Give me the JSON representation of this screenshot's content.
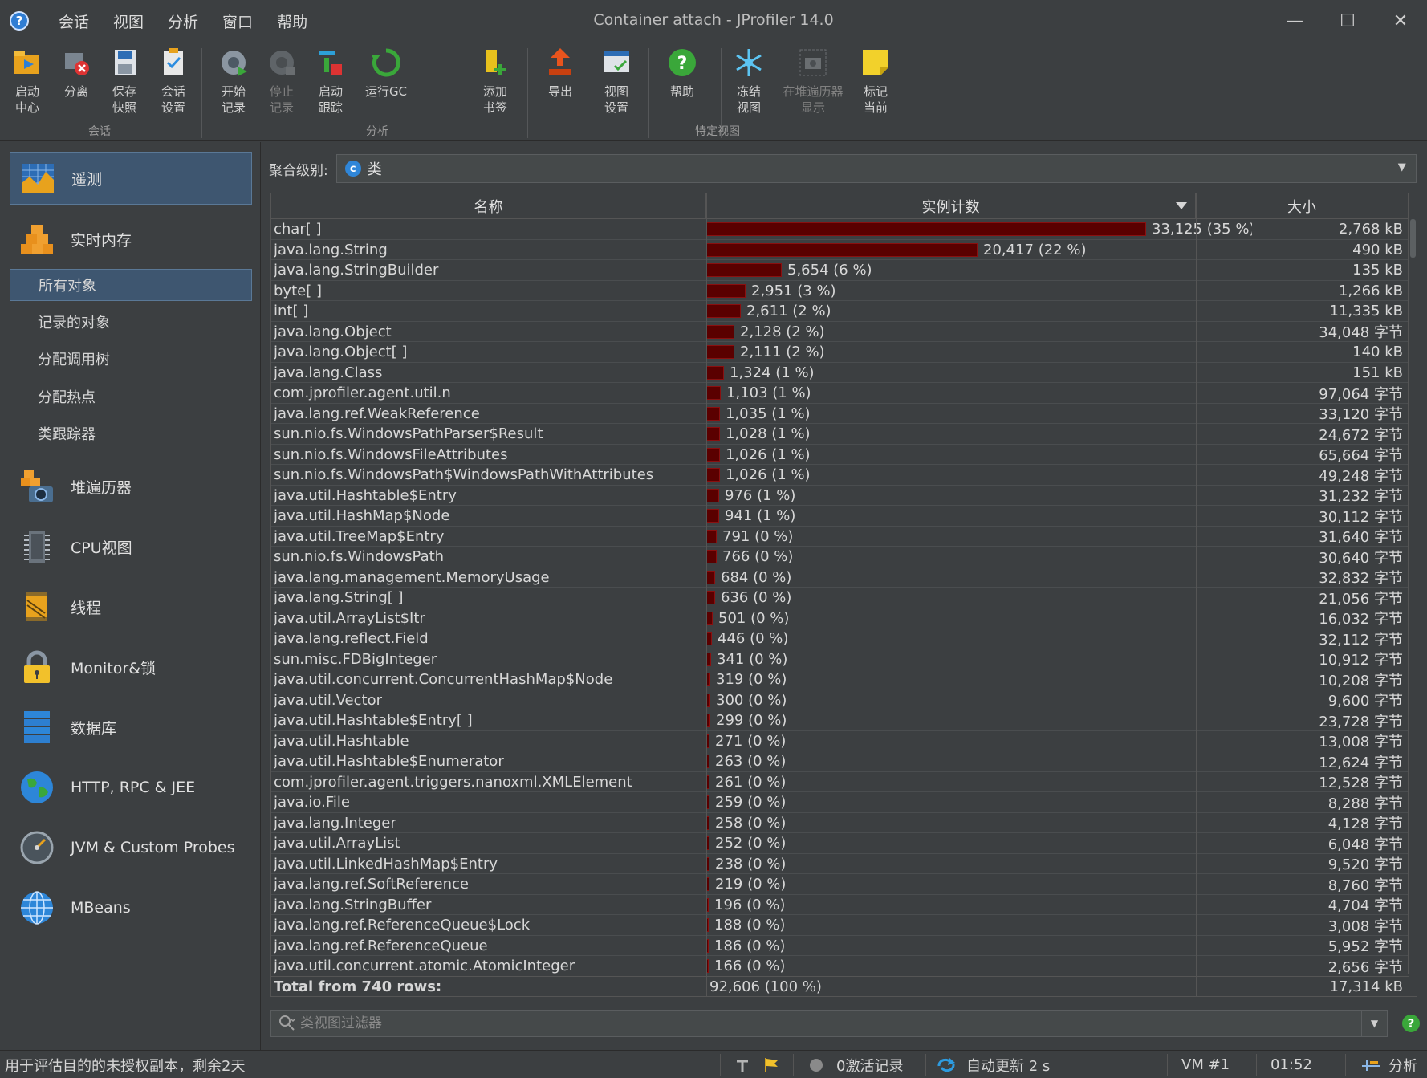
{
  "app": {
    "title": "Container attach - JProfiler 14.0",
    "menu": [
      "会话",
      "视图",
      "分析",
      "窗口",
      "帮助"
    ],
    "window_controls": {
      "minimize": "—",
      "maximize": "☐",
      "close": "✕"
    }
  },
  "toolbar": {
    "buttons": [
      {
        "label": "启动\n中心",
        "icon": "start-center-icon",
        "enabled": true
      },
      {
        "label": "分离",
        "icon": "detach-icon",
        "enabled": true
      },
      {
        "label": "保存\n快照",
        "icon": "save-snapshot-icon",
        "enabled": true
      },
      {
        "label": "会话\n设置",
        "icon": "session-settings-icon",
        "enabled": true
      },
      {
        "label": "开始\n记录",
        "icon": "start-recording-icon",
        "enabled": true
      },
      {
        "label": "停止\n记录",
        "icon": "stop-recording-icon",
        "enabled": false
      },
      {
        "label": "启动\n跟踪",
        "icon": "start-tracking-icon",
        "enabled": true
      },
      {
        "label": "运行GC",
        "icon": "run-gc-icon",
        "enabled": true
      },
      {
        "label": "添加\n书签",
        "icon": "add-bookmark-icon",
        "enabled": true
      },
      {
        "label": "导出",
        "icon": "export-icon",
        "enabled": true
      },
      {
        "label": "视图\n设置",
        "icon": "view-settings-icon",
        "enabled": true
      },
      {
        "label": "帮助",
        "icon": "help-icon",
        "enabled": true
      },
      {
        "label": "冻结\n视图",
        "icon": "freeze-view-icon",
        "enabled": true
      },
      {
        "label": "在堆遍历器\n显示",
        "icon": "show-in-heap-walker-icon",
        "enabled": false
      },
      {
        "label": "标记\n当前",
        "icon": "mark-current-icon",
        "enabled": true
      }
    ],
    "groups": [
      "会话",
      "分析",
      "特定视图"
    ]
  },
  "sidebar": {
    "sections": [
      {
        "label": "遥测",
        "icon": "telemetry-icon",
        "selected": true
      },
      {
        "label": "实时内存",
        "icon": "live-memory-icon",
        "selected": false
      },
      {
        "label": "堆遍历器",
        "icon": "heap-walker-icon",
        "selected": false
      },
      {
        "label": "CPU视图",
        "icon": "cpu-views-icon",
        "selected": false
      },
      {
        "label": "线程",
        "icon": "threads-icon",
        "selected": false
      },
      {
        "label": "Monitor&锁",
        "icon": "monitors-locks-icon",
        "selected": false
      },
      {
        "label": "数据库",
        "icon": "databases-icon",
        "selected": false
      },
      {
        "label": "HTTP, RPC & JEE",
        "icon": "http-rpc-jee-icon",
        "selected": false
      },
      {
        "label": "JVM & Custom Probes",
        "icon": "jvm-probes-icon",
        "selected": false
      },
      {
        "label": "MBeans",
        "icon": "mbeans-icon",
        "selected": false
      }
    ],
    "live_memory_items": [
      {
        "label": "所有对象",
        "selected": true
      },
      {
        "label": "记录的对象",
        "selected": false
      },
      {
        "label": "分配调用树",
        "selected": false
      },
      {
        "label": "分配热点",
        "selected": false
      },
      {
        "label": "类跟踪器",
        "selected": false
      }
    ]
  },
  "aggregation": {
    "label": "聚合级别:",
    "value": "类",
    "icon": "class-icon",
    "icon_letter": "c"
  },
  "table": {
    "columns": [
      "名称",
      "实例计数",
      "大小"
    ],
    "max_count": 33125,
    "rows": [
      {
        "name": "char[ ]",
        "count": 33125,
        "count_text": "33,125 (35 %)",
        "size": "2,768 kB"
      },
      {
        "name": "java.lang.String",
        "count": 20417,
        "count_text": "20,417 (22 %)",
        "size": "490 kB"
      },
      {
        "name": "java.lang.StringBuilder",
        "count": 5654,
        "count_text": "5,654 (6 %)",
        "size": "135 kB"
      },
      {
        "name": "byte[ ]",
        "count": 2951,
        "count_text": "2,951 (3 %)",
        "size": "1,266 kB"
      },
      {
        "name": "int[ ]",
        "count": 2611,
        "count_text": "2,611 (2 %)",
        "size": "11,335 kB"
      },
      {
        "name": "java.lang.Object",
        "count": 2128,
        "count_text": "2,128 (2 %)",
        "size": "34,048 字节"
      },
      {
        "name": "java.lang.Object[ ]",
        "count": 2111,
        "count_text": "2,111 (2 %)",
        "size": "140 kB"
      },
      {
        "name": "java.lang.Class",
        "count": 1324,
        "count_text": "1,324 (1 %)",
        "size": "151 kB"
      },
      {
        "name": "com.jprofiler.agent.util.n",
        "count": 1103,
        "count_text": "1,103 (1 %)",
        "size": "97,064 字节"
      },
      {
        "name": "java.lang.ref.WeakReference",
        "count": 1035,
        "count_text": "1,035 (1 %)",
        "size": "33,120 字节"
      },
      {
        "name": "sun.nio.fs.WindowsPathParser$Result",
        "count": 1028,
        "count_text": "1,028 (1 %)",
        "size": "24,672 字节"
      },
      {
        "name": "sun.nio.fs.WindowsFileAttributes",
        "count": 1026,
        "count_text": "1,026 (1 %)",
        "size": "65,664 字节"
      },
      {
        "name": "sun.nio.fs.WindowsPath$WindowsPathWithAttributes",
        "count": 1026,
        "count_text": "1,026 (1 %)",
        "size": "49,248 字节"
      },
      {
        "name": "java.util.Hashtable$Entry",
        "count": 976,
        "count_text": "976 (1 %)",
        "size": "31,232 字节"
      },
      {
        "name": "java.util.HashMap$Node",
        "count": 941,
        "count_text": "941 (1 %)",
        "size": "30,112 字节"
      },
      {
        "name": "java.util.TreeMap$Entry",
        "count": 791,
        "count_text": "791 (0 %)",
        "size": "31,640 字节"
      },
      {
        "name": "sun.nio.fs.WindowsPath",
        "count": 766,
        "count_text": "766 (0 %)",
        "size": "30,640 字节"
      },
      {
        "name": "java.lang.management.MemoryUsage",
        "count": 684,
        "count_text": "684 (0 %)",
        "size": "32,832 字节"
      },
      {
        "name": "java.lang.String[ ]",
        "count": 636,
        "count_text": "636 (0 %)",
        "size": "21,056 字节"
      },
      {
        "name": "java.util.ArrayList$Itr",
        "count": 501,
        "count_text": "501 (0 %)",
        "size": "16,032 字节"
      },
      {
        "name": "java.lang.reflect.Field",
        "count": 446,
        "count_text": "446 (0 %)",
        "size": "32,112 字节"
      },
      {
        "name": "sun.misc.FDBigInteger",
        "count": 341,
        "count_text": "341 (0 %)",
        "size": "10,912 字节"
      },
      {
        "name": "java.util.concurrent.ConcurrentHashMap$Node",
        "count": 319,
        "count_text": "319 (0 %)",
        "size": "10,208 字节"
      },
      {
        "name": "java.util.Vector",
        "count": 300,
        "count_text": "300 (0 %)",
        "size": "9,600 字节"
      },
      {
        "name": "java.util.Hashtable$Entry[ ]",
        "count": 299,
        "count_text": "299 (0 %)",
        "size": "23,728 字节"
      },
      {
        "name": "java.util.Hashtable",
        "count": 271,
        "count_text": "271 (0 %)",
        "size": "13,008 字节"
      },
      {
        "name": "java.util.Hashtable$Enumerator",
        "count": 263,
        "count_text": "263 (0 %)",
        "size": "12,624 字节"
      },
      {
        "name": "com.jprofiler.agent.triggers.nanoxml.XMLElement",
        "count": 261,
        "count_text": "261 (0 %)",
        "size": "12,528 字节"
      },
      {
        "name": "java.io.File",
        "count": 259,
        "count_text": "259 (0 %)",
        "size": "8,288 字节"
      },
      {
        "name": "java.lang.Integer",
        "count": 258,
        "count_text": "258 (0 %)",
        "size": "4,128 字节"
      },
      {
        "name": "java.util.ArrayList",
        "count": 252,
        "count_text": "252 (0 %)",
        "size": "6,048 字节"
      },
      {
        "name": "java.util.LinkedHashMap$Entry",
        "count": 238,
        "count_text": "238 (0 %)",
        "size": "9,520 字节"
      },
      {
        "name": "java.lang.ref.SoftReference",
        "count": 219,
        "count_text": "219 (0 %)",
        "size": "8,760 字节"
      },
      {
        "name": "java.lang.StringBuffer",
        "count": 196,
        "count_text": "196 (0 %)",
        "size": "4,704 字节"
      },
      {
        "name": "java.lang.ref.ReferenceQueue$Lock",
        "count": 188,
        "count_text": "188 (0 %)",
        "size": "3,008 字节"
      },
      {
        "name": "java.lang.ref.ReferenceQueue",
        "count": 186,
        "count_text": "186 (0 %)",
        "size": "5,952 字节"
      },
      {
        "name": "java.util.concurrent.atomic.AtomicInteger",
        "count": 166,
        "count_text": "166 (0 %)",
        "size": "2,656 字节"
      }
    ],
    "total": {
      "name": "Total from 740 rows:",
      "count_text": "92,606 (100 %)",
      "size": "17,314 kB"
    }
  },
  "filter": {
    "placeholder": "类视图过滤器",
    "icon": "search-icon"
  },
  "status": {
    "license": "用于评估目的的未授权副本，剩余2天",
    "recordings": "0激活记录",
    "auto_update": "自动更新 2 s",
    "vm": "VM #1",
    "time": "01:52",
    "mode": "分析"
  },
  "colors": {
    "bar_fill": "#5a0000",
    "bar_border": "#8a1010",
    "selection": "#3e5670",
    "background": "#3c3f41"
  }
}
